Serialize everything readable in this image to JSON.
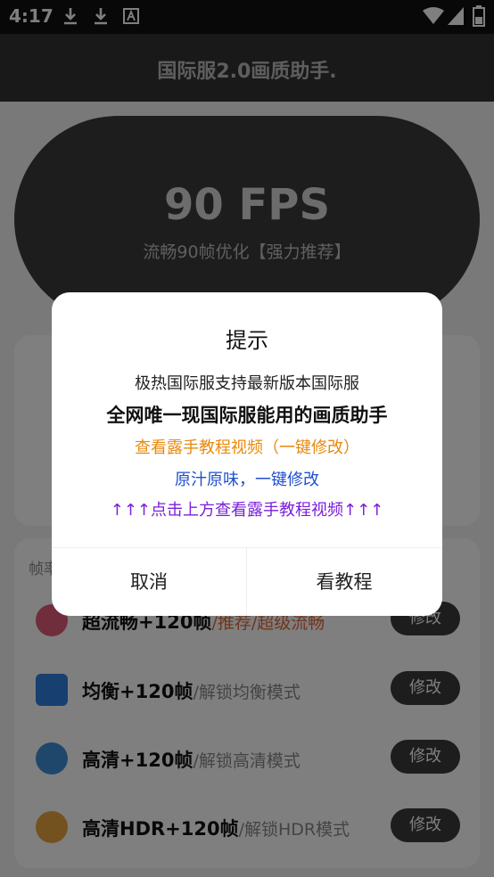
{
  "status_bar": {
    "time": "4:17"
  },
  "app": {
    "title": "国际服2.0画质助手."
  },
  "fps_card": {
    "title": "90 FPS",
    "subtitle": "流畅90帧优化【强力推荐】"
  },
  "section": {
    "label": "帧率"
  },
  "modes": [
    {
      "name": "超流畅+120帧",
      "desc": "/推荐/超级流畅",
      "button": "修改",
      "icon": "rose-icon",
      "color": "#e05a76"
    },
    {
      "name": "均衡+120帧",
      "desc": "/解锁均衡模式",
      "button": "修改",
      "icon": "w-icon",
      "color": "#2f7fe0"
    },
    {
      "name": "高清+120帧",
      "desc": "/解锁高清模式",
      "button": "修改",
      "icon": "cloud-icon",
      "color": "#3f8fd8"
    },
    {
      "name": "高清HDR+120帧",
      "desc": "/解锁HDR模式",
      "button": "修改",
      "icon": "sun-cloud-icon",
      "color": "#e9a441"
    }
  ],
  "dialog": {
    "title": "提示",
    "line1": "极热国际服支持最新版本国际服",
    "line2": "全网唯一现国际服能用的画质助手",
    "line3": "查看露手教程视频（一键修改）",
    "line4": "原汁原味，一键修改",
    "line5": "↑↑↑点击上方查看露手教程视频↑↑↑",
    "cancel": "取消",
    "confirm": "看教程"
  },
  "colors": {
    "orange": "#e8890c",
    "blue": "#1f4fd0",
    "purple": "#7a1fd8"
  }
}
